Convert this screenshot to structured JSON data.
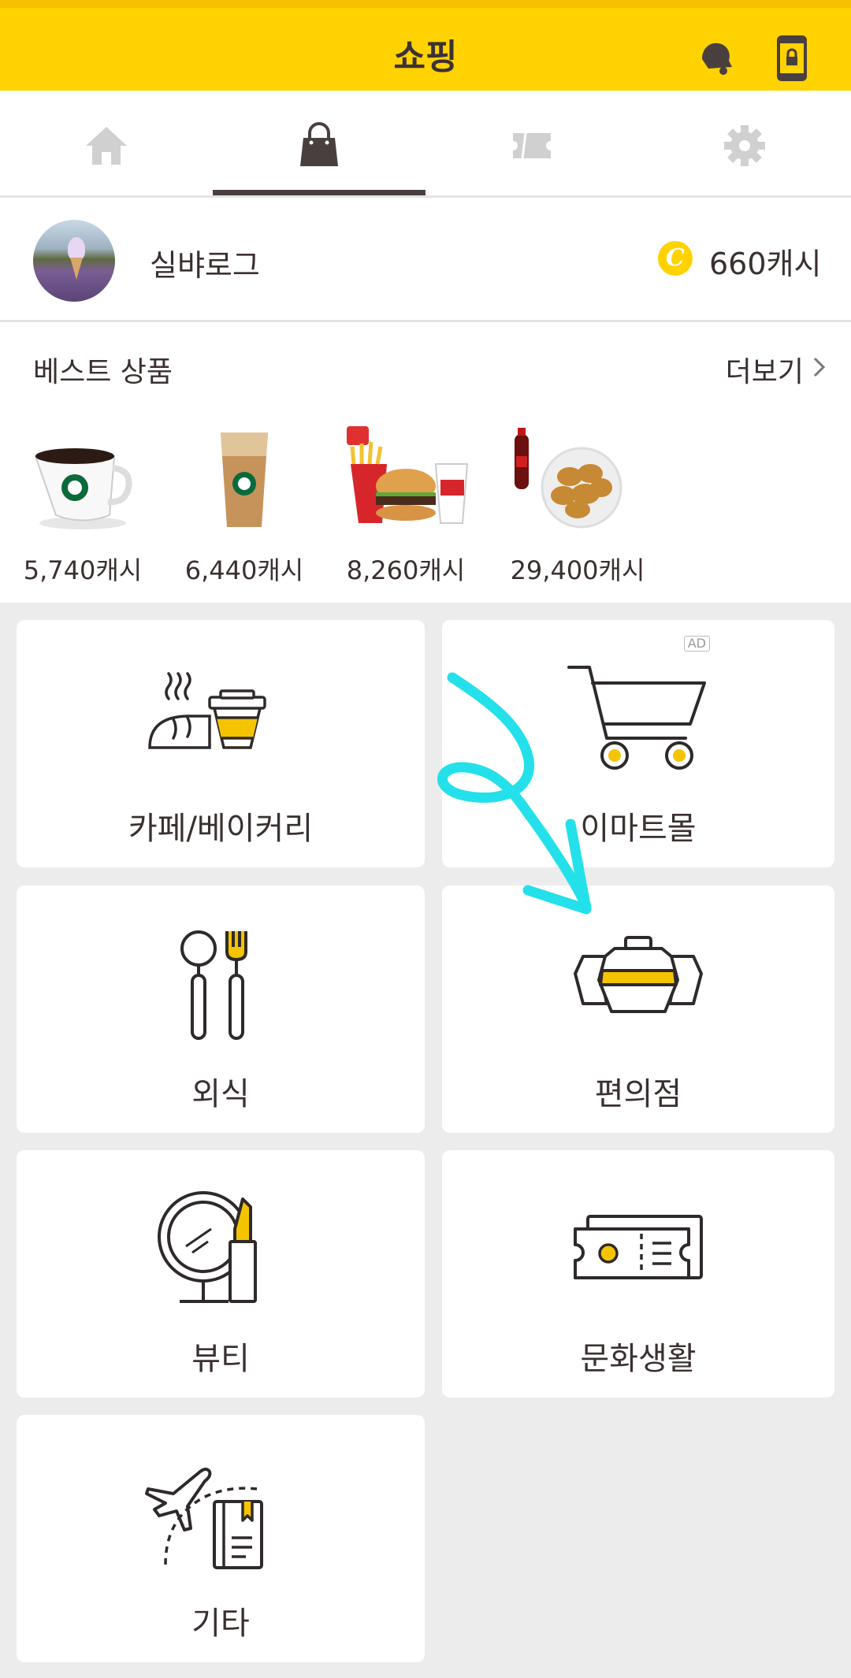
{
  "header": {
    "title": "쇼핑",
    "bell_icon": "bell-icon",
    "lock_icon": "phone-lock-icon",
    "bg": "#ffd200"
  },
  "tabs": [
    {
      "name": "home",
      "icon": "home-icon",
      "active": false
    },
    {
      "name": "shopping",
      "icon": "shopping-bag-icon",
      "active": true
    },
    {
      "name": "coupon",
      "icon": "ticket-icon",
      "active": false
    },
    {
      "name": "settings",
      "icon": "gear-icon",
      "active": false
    }
  ],
  "profile": {
    "name": "실뱌로그",
    "cash": "660캐시",
    "coin_symbol": "C"
  },
  "best": {
    "title": "베스트 상품",
    "more": "더보기",
    "products": [
      {
        "price": "5,740캐시",
        "image": "starbucks-hot-coffee"
      },
      {
        "price": "6,440캐시",
        "image": "starbucks-iced-latte"
      },
      {
        "price": "8,260캐시",
        "image": "lotteria-burger-set"
      },
      {
        "price": "29,400캐시",
        "image": "chicken-cola-set"
      }
    ]
  },
  "categories": [
    {
      "label": "카페/베이커리",
      "icon": "cafe-bakery-icon"
    },
    {
      "label": "이마트몰",
      "icon": "shopping-cart-icon",
      "ad": "AD"
    },
    {
      "label": "외식",
      "icon": "dining-icon"
    },
    {
      "label": "편의점",
      "icon": "convenience-store-icon"
    },
    {
      "label": "뷰티",
      "icon": "beauty-mirror-icon"
    },
    {
      "label": "문화생활",
      "icon": "culture-ticket-icon"
    },
    {
      "label": "기타",
      "icon": "travel-etc-icon"
    }
  ],
  "annotation": {
    "color": "#24e0ea"
  }
}
